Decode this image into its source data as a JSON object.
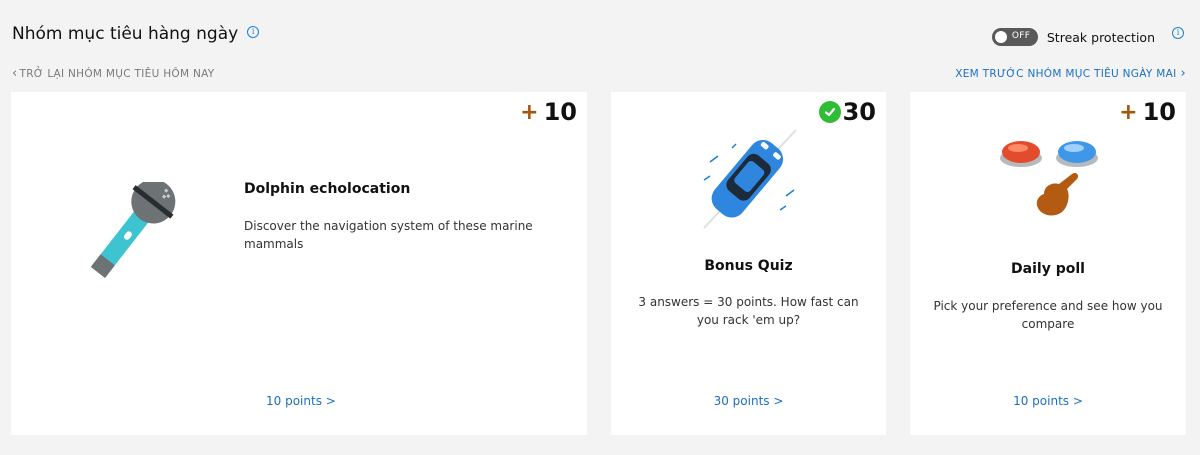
{
  "header": {
    "title": "Nhóm mục tiêu hàng ngày"
  },
  "streak": {
    "toggle_state": "OFF",
    "label": "Streak protection"
  },
  "nav": {
    "back_label": "TRỞ LẠI NHÓM MỤC TIÊU HÔM NAY",
    "next_label": "XEM TRƯỚC NHÓM MỤC TIÊU NGÀY MAI"
  },
  "cards": [
    {
      "points_badge": "10",
      "badge_type": "plus",
      "title": "Dolphin echolocation",
      "description": "Discover the navigation system of these marine mammals",
      "link": "10 points >",
      "illustration": "microphone-icon"
    },
    {
      "points_badge": "30",
      "badge_type": "completed",
      "title": "Bonus Quiz",
      "description": "3 answers = 30 points. How fast can you rack 'em up?",
      "link": "30 points >",
      "illustration": "race-car-icon"
    },
    {
      "points_badge": "10",
      "badge_type": "plus",
      "title": "Daily poll",
      "description": "Pick your preference and see how you compare",
      "link": "10 points >",
      "illustration": "poll-buttons-icon"
    }
  ],
  "colors": {
    "accent": "#1c6fc0",
    "plus": "#a3570e",
    "check": "#2fbd36",
    "toggle_off": "#595959"
  }
}
